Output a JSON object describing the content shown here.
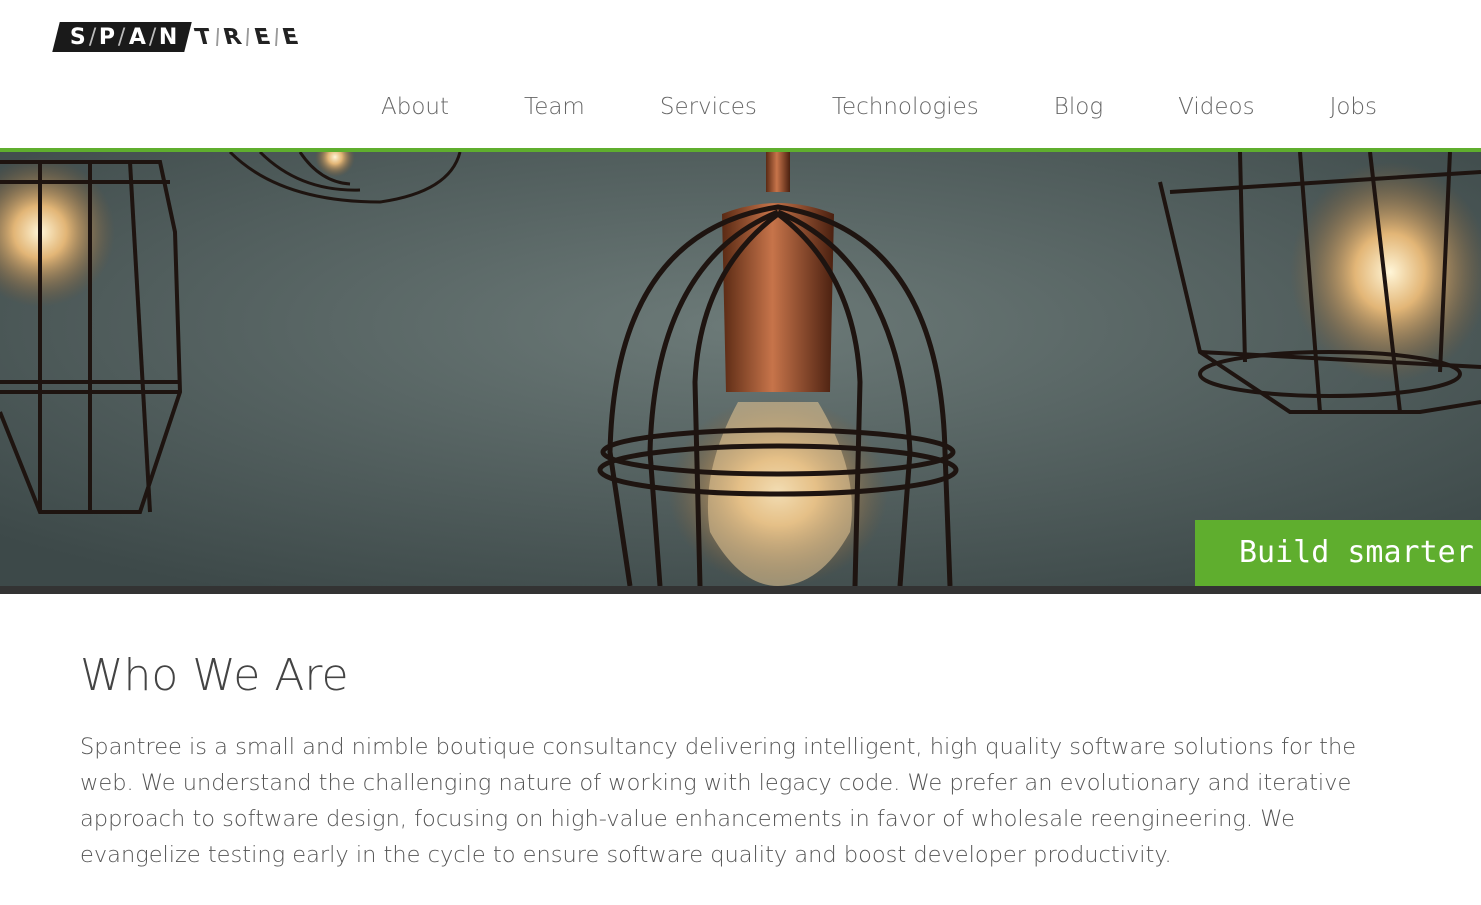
{
  "brand": {
    "logo_dark_letters": [
      "S",
      "P",
      "A",
      "N"
    ],
    "logo_light_letters": [
      "T",
      "R",
      "E",
      "E"
    ]
  },
  "nav": {
    "items": [
      {
        "label": "About"
      },
      {
        "label": "Team"
      },
      {
        "label": "Services"
      },
      {
        "label": "Technologies"
      },
      {
        "label": "Blog"
      },
      {
        "label": "Videos"
      },
      {
        "label": "Jobs"
      }
    ]
  },
  "hero": {
    "tagline": "Build smarter s"
  },
  "about": {
    "title": "Who We Are",
    "body": "Spantree is a small and nimble boutique consultancy delivering intelligent, high quality software solutions for the web. We understand the challenging nature of working with legacy code. We prefer an evolutionary and iterative approach to software design, focusing on high-value enhancements in favor of wholesale reengineering. We evangelize testing early in the cycle to ensure software quality and boost developer productivity."
  },
  "colors": {
    "accent_green": "#5fae2e",
    "logo_dark": "#1a1a1a",
    "hero_strip": "#333333"
  }
}
